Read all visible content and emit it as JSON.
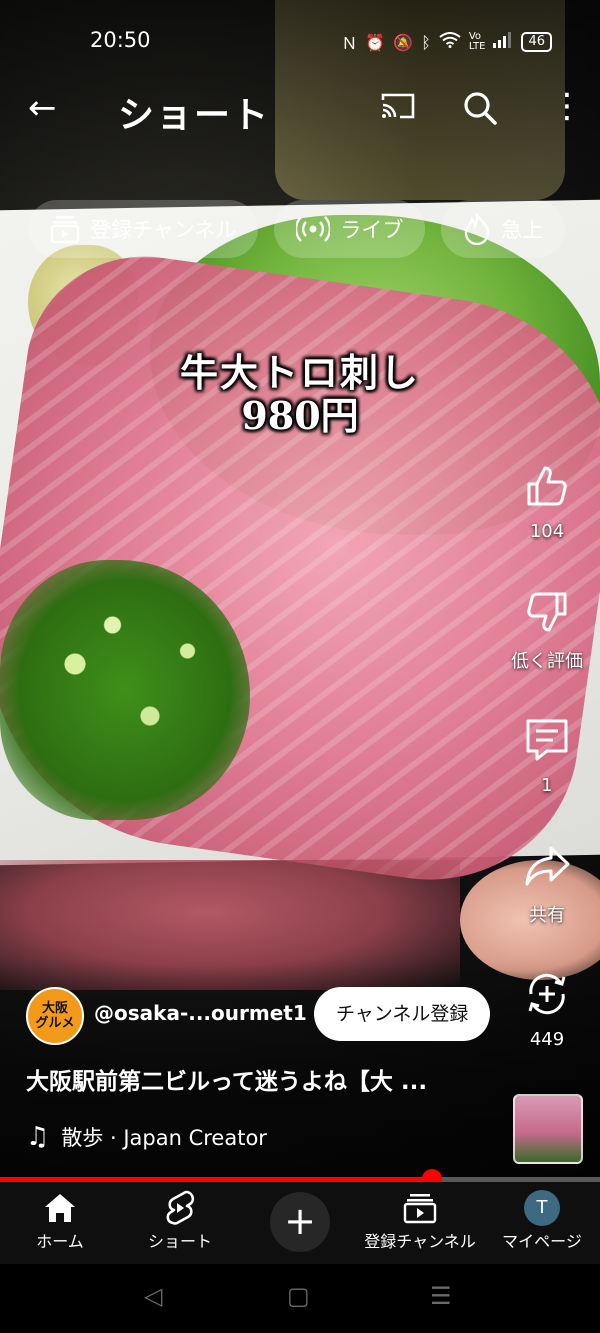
{
  "status_bar": {
    "time": "20:50",
    "battery": "46"
  },
  "app_bar": {
    "title": "ショート",
    "back_icon": "arrow-left-icon",
    "cast_icon": "cast-icon",
    "search_icon": "search-icon",
    "more_icon": "more-vert-icon"
  },
  "chips": [
    {
      "label": "登録チャンネル",
      "icon": "subscriptions-icon"
    },
    {
      "label": "ライブ",
      "icon": "live-icon"
    },
    {
      "label": "急上",
      "icon": "trending-flame-icon"
    }
  ],
  "video": {
    "overlay_line1": "牛大トロ刺し",
    "overlay_line2": "980円",
    "progress": 0.72
  },
  "actions": {
    "like_count": "104",
    "dislike_label": "低く評価",
    "comment_count": "1",
    "share_label": "共有",
    "remix_count": "449"
  },
  "channel": {
    "avatar_text": "大阪\nグルメ",
    "handle": "@osaka-...ourmet1",
    "subscribe_label": "チャンネル登録"
  },
  "title": "大阪駅前第二ビルって迷うよね【大 ...",
  "music": "散歩 · Japan Creator",
  "bottom_nav": [
    {
      "label": "ホーム",
      "icon": "home-icon"
    },
    {
      "label": "ショート",
      "icon": "shorts-icon"
    },
    {
      "label": "",
      "icon": "plus-icon"
    },
    {
      "label": "登録チャンネル",
      "icon": "subscriptions-icon"
    },
    {
      "label": "マイページ",
      "icon": "avatar-icon",
      "avatar_letter": "T"
    }
  ],
  "colors": {
    "accent_red": "#ff0000",
    "nav_bg": "#0f0f0f",
    "avatar_orange": "#f39a1b",
    "account_avatar": "#3d6a82"
  }
}
